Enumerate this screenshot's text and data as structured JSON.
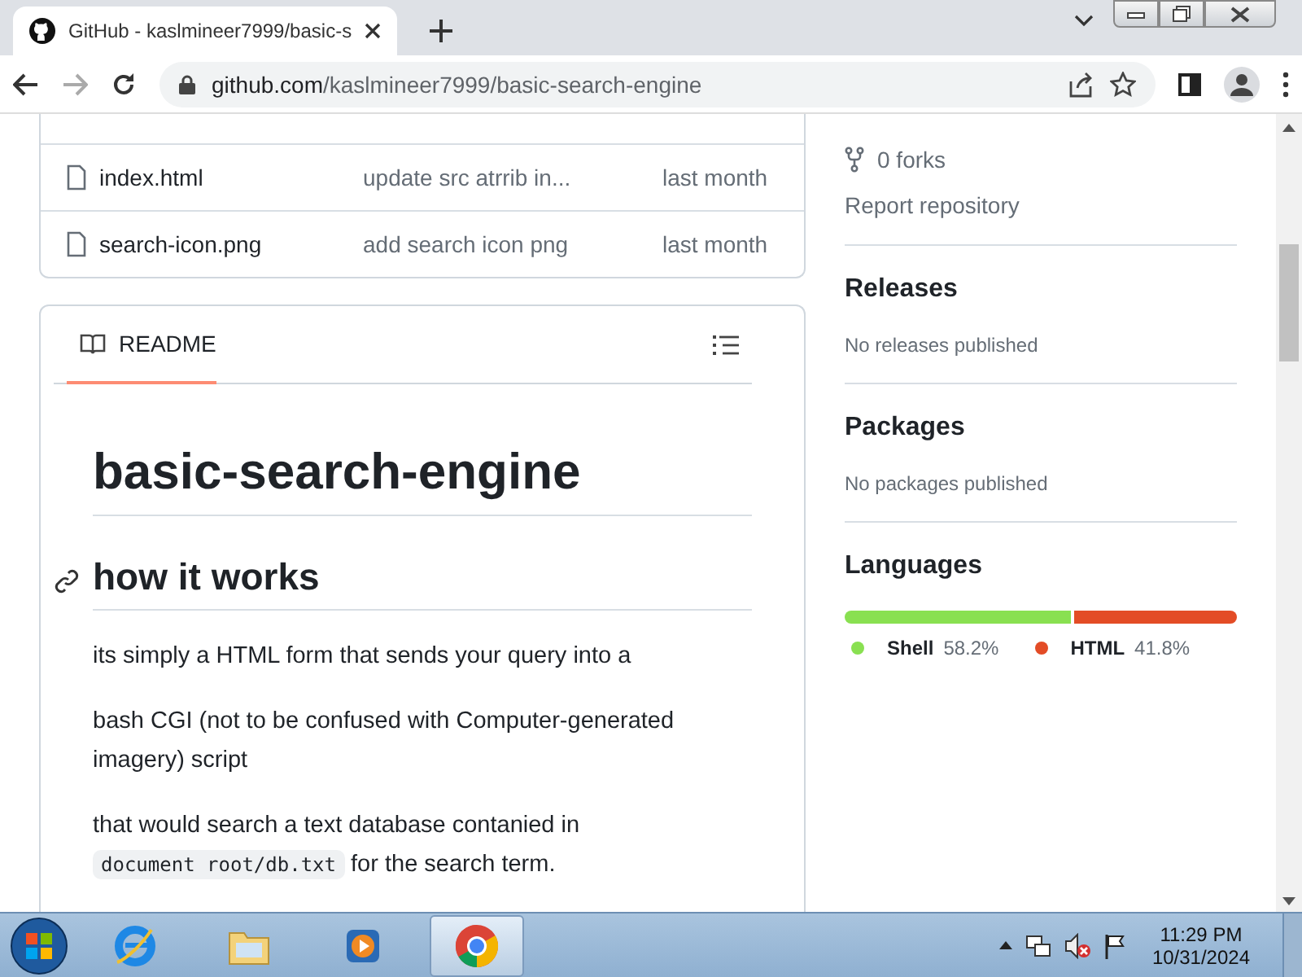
{
  "browser": {
    "tab": {
      "title": "GitHub - kaslmineer7999/basic-s",
      "selected": true
    },
    "address": {
      "domain": "github.com",
      "path": "/kaslmineer7999/basic-search-engine"
    }
  },
  "files": [
    {
      "name": "index.html",
      "message": "update src atrrib in...",
      "time": "last month"
    },
    {
      "name": "search-icon.png",
      "message": "add search icon png",
      "time": "last month"
    }
  ],
  "readme": {
    "tab": {
      "label": "README",
      "selected": true
    },
    "title": "basic-search-engine",
    "heading": "how it works",
    "paragraphs": [
      [
        {
          "kind": "text",
          "text": "its simply a HTML form that sends your query into a"
        }
      ],
      [
        {
          "kind": "text",
          "text": "bash CGI (not to be confused with Computer-generated imagery) script"
        }
      ],
      [
        {
          "kind": "text",
          "text": "that would search a text database contanied in "
        },
        {
          "kind": "code",
          "text": "document root/db.txt"
        },
        {
          "kind": "text",
          "text": " for the search term."
        }
      ]
    ]
  },
  "sidebar": {
    "forks": "0 forks",
    "report": "Report repository",
    "sections": [
      {
        "title": "Releases",
        "note": "No releases published"
      },
      {
        "title": "Packages",
        "note": "No packages published"
      }
    ],
    "languages": {
      "title": "Languages",
      "items": [
        {
          "name": "Shell",
          "percent": "58.2%",
          "color": "#89e051",
          "level": 0.582
        },
        {
          "name": "HTML",
          "percent": "41.8%",
          "color": "#e34c26",
          "level": 0.418
        }
      ]
    }
  },
  "taskbar": {
    "apps": [
      {
        "kind": "ie",
        "selected": false
      },
      {
        "kind": "explorer",
        "selected": false
      },
      {
        "kind": "media",
        "selected": false
      },
      {
        "kind": "chrome",
        "selected": true
      }
    ],
    "time": "11:29 PM",
    "date": "10/31/2024"
  }
}
